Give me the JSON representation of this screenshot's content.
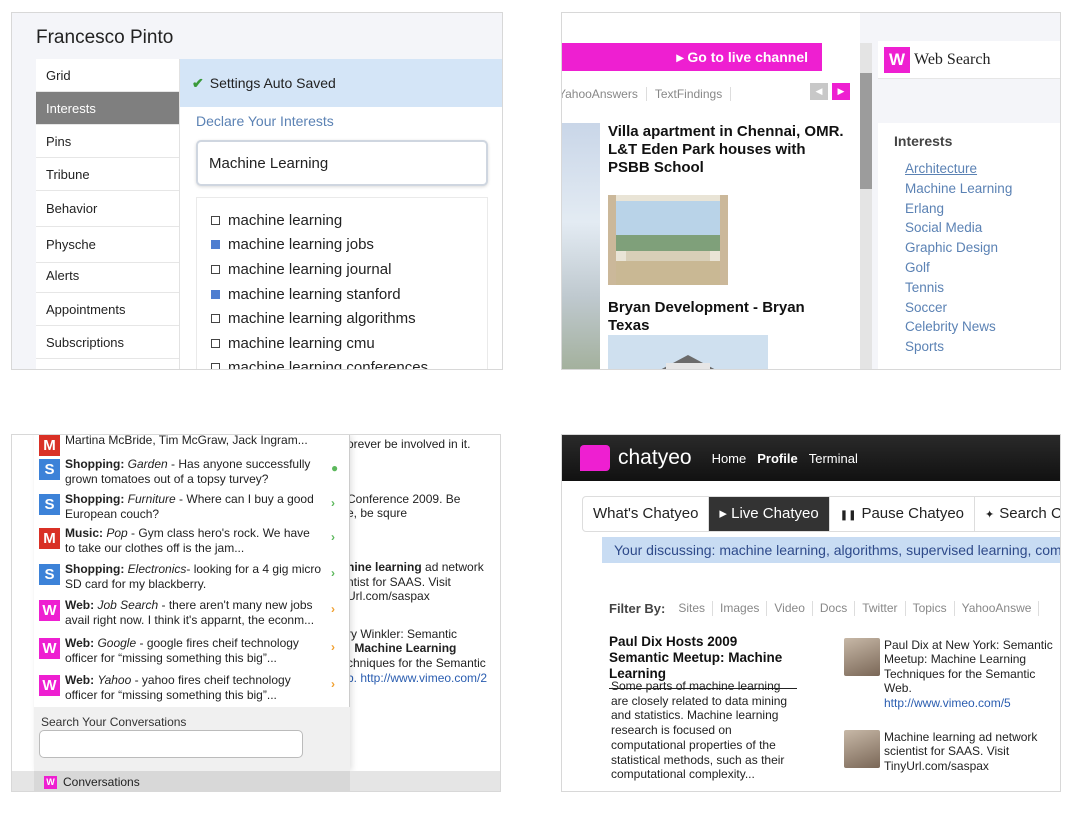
{
  "profile_panel": {
    "user_name": "Francesco Pinto",
    "nav_items": [
      "Grid",
      "Interests",
      "Pins",
      "Tribune",
      "Behavior",
      "Physche",
      "Alerts",
      "Appointments",
      "Subscriptions"
    ],
    "active_nav": "Interests",
    "saved_status": "Settings Auto Saved",
    "declare_heading": "Declare Your Interests",
    "interest_input_value": "Machine Learning",
    "suggestions": [
      {
        "text": "machine learning",
        "checked": false
      },
      {
        "text": "machine learning jobs",
        "checked": true
      },
      {
        "text": "machine learning journal",
        "checked": false
      },
      {
        "text": "machine learning stanford",
        "checked": true
      },
      {
        "text": "machine learning algorithms",
        "checked": false
      },
      {
        "text": "machine learning cmu",
        "checked": false
      },
      {
        "text": "machine learning conferences",
        "checked": false
      }
    ]
  },
  "search_panel": {
    "live_channel": "▸ Go to live channel",
    "source_tabs": [
      "YahooAnswers",
      "TextFindings"
    ],
    "articles": [
      {
        "title": "Villa apartment in Chennai, OMR. L&T Eden Park houses with PSBB School"
      },
      {
        "title": "Bryan Development - Bryan Texas"
      }
    ],
    "web_search_title": "Web Search",
    "w_logo": "W",
    "interests_heading": "Interests",
    "interests": [
      "Architecture",
      "Machine Learning",
      "Erlang",
      "Social Media",
      "Graphic Design",
      "Golf",
      "Tennis",
      "Soccer",
      "Celebrity News",
      "Sports"
    ]
  },
  "conversations_panel": {
    "background_lines": [
      "orever be involved in it.",
      "Conference 2009. Be",
      "e, be squre",
      "ntist for SAAS. Visit",
      "Url.com/saspax",
      "ry Winkler: Semantic",
      "chniques for the Semantic",
      "b. http://www.vimeo.com/2"
    ],
    "conversations": [
      {
        "badge": "M",
        "color": "#d93025",
        "category": "",
        "sub": "",
        "text": "Martina McBride, Tim McGraw, Jack Ingram...",
        "dot": ""
      },
      {
        "badge": "S",
        "color": "#3c82d8",
        "category": "Shopping:",
        "sub": "Garden",
        "text": " - Has anyone successfully grown tomatoes out of a topsy turvey?",
        "dot": "●",
        "dot_color": "#5cb85c"
      },
      {
        "badge": "S",
        "color": "#3c82d8",
        "category": "Shopping:",
        "sub": "Furniture",
        "text": " - Where can I buy a good European couch?",
        "dot": "›",
        "dot_color": "#5cb85c"
      },
      {
        "badge": "M",
        "color": "#d93025",
        "category": "Music:",
        "sub": "Pop",
        "text": " - Gym class hero's rock. We have to take our clothes off is the jam...",
        "dot": "›",
        "dot_color": "#5cb85c"
      },
      {
        "badge": "S",
        "color": "#3c82d8",
        "category": "Shopping:",
        "sub": "Electronics",
        "text": "- looking for a 4 gig micro SD card for my blackberry.",
        "dot": "›",
        "dot_color": "#5cb85c"
      },
      {
        "badge": "W",
        "color": "#ee1fd1",
        "category": "Web:",
        "sub": "Job Search",
        "text": " - there aren't many new jobs avail right now. I think it's apparnt, the econm...",
        "dot": "›",
        "dot_color": "#f0a030"
      },
      {
        "badge": "W",
        "color": "#ee1fd1",
        "category": "Web:",
        "sub": "Google",
        "text": " - google fires cheif technology officer for “missing something this big”...",
        "dot": "›",
        "dot_color": "#f0a030"
      },
      {
        "badge": "W",
        "color": "#ee1fd1",
        "category": "Web:",
        "sub": "Yahoo",
        "text": " - yahoo fires cheif technology officer for “missing something this big”...",
        "dot": "›",
        "dot_color": "#f0a030"
      }
    ],
    "search_label": "Search Your Conversations",
    "search_value": "",
    "tab_label": "Conversations"
  },
  "chatyeo_panel": {
    "logo_text": "chatyeo",
    "nav": [
      "Home",
      "Profile",
      "Terminal"
    ],
    "modes": [
      "What's Chatyeo",
      "▸ Live Chatyeo",
      "Pause Chatyeo",
      "Search Chat"
    ],
    "discussing": "Your discussing: machine learning, algorithms, supervised learning, com",
    "filter_label": "Filter By:",
    "filters": [
      "Sites",
      "Images",
      "Video",
      "Docs",
      "Twitter",
      "Topics",
      "YahooAnswe"
    ],
    "story_title": "Paul Dix Hosts 2009 Semantic Meetup: Machine Learning",
    "story_body": "Some parts of machine learning are closely related to data mining and statistics. Machine learning research is focused on computational properties of the statistical methods, such as their computational complexity...",
    "tweets": [
      {
        "text": "Paul Dix at New York: Semantic Meetup: Machine Learning Techniques for the Semantic Web.",
        "link": "http://www.vimeo.com/5"
      },
      {
        "text": "Machine learning ad network scientist for SAAS. Visit TinyUrl.com/saspax",
        "link": ""
      }
    ],
    "accent_color": "#ee1fd1"
  }
}
